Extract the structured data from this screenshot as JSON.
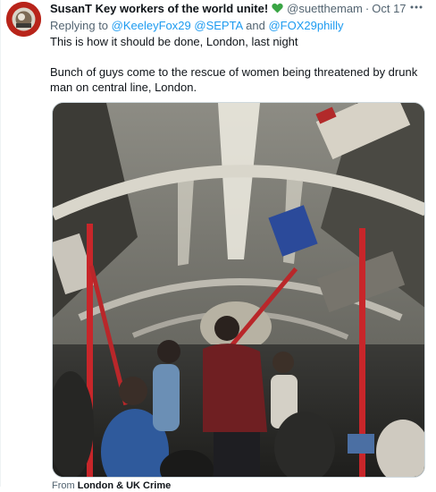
{
  "tweet": {
    "display_name": "SusanT Key workers of the world unite!",
    "handle": "@suetthemam",
    "separator": "·",
    "timestamp": "Oct 17",
    "replying_prefix": "Replying to",
    "mentions": [
      "@KeeleyFox29",
      "@SEPTA",
      "@FOX29philly"
    ],
    "mention_joiner": "and",
    "text_lines": [
      "This is how it should be done, London, last night",
      "",
      "Bunch of guys come to the rescue of women being threatened by drunk",
      "man on central line, London."
    ],
    "from_prefix": "From",
    "from_source": "London & UK Crime"
  },
  "icons": {
    "heart": "green-heart-icon",
    "more": "more-options-icon"
  },
  "colors": {
    "mention_blue": "#1d9bf0",
    "secondary_text": "#536471",
    "heart_green": "#3aa545",
    "pole_red": "#c8262a"
  }
}
